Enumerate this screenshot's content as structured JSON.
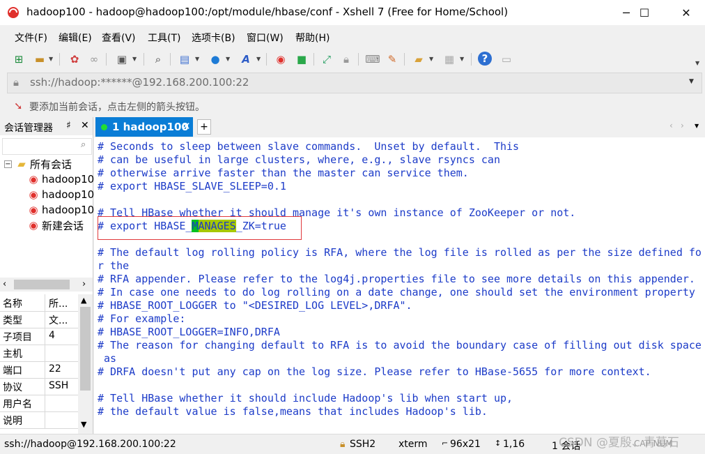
{
  "window": {
    "title": "hadoop100 - hadoop@hadoop100:/opt/module/hbase/conf - Xshell 7 (Free for Home/School)",
    "controls": [
      "─",
      "☐",
      "✕"
    ]
  },
  "menu": [
    "文件(F)",
    "编辑(E)",
    "查看(V)",
    "工具(T)",
    "选项卡(B)",
    "窗口(W)",
    "帮助(H)"
  ],
  "address": {
    "value": "ssh://hadoop:******@192.168.200.100:22"
  },
  "hint": {
    "text": "要添加当前会话，点击左侧的箭头按钮。"
  },
  "session_manager": {
    "title": "会话管理器",
    "pin": "♯",
    "close": "✕",
    "root": "所有会话",
    "items": [
      "hadoop10",
      "hadoop10",
      "hadoop10",
      "新建会话"
    ]
  },
  "properties": [
    {
      "k": "名称",
      "v": "所..."
    },
    {
      "k": "类型",
      "v": "文..."
    },
    {
      "k": "子项目",
      "v": "4"
    },
    {
      "k": "主机",
      "v": ""
    },
    {
      "k": "端口",
      "v": "22"
    },
    {
      "k": "协议",
      "v": "SSH"
    },
    {
      "k": "用户名",
      "v": ""
    },
    {
      "k": "说明",
      "v": ""
    }
  ],
  "tabs": [
    {
      "label": "1 hadoop100",
      "close": "✕"
    }
  ],
  "add_tab": "+",
  "terminal": {
    "lines": [
      "# Seconds to sleep between slave commands.  Unset by default.  This",
      "# can be useful in large clusters, where, e.g., slave rsyncs can",
      "# otherwise arrive faster than the master can service them.",
      "# export HBASE_SLAVE_SLEEP=0.1",
      "",
      "# Tell HBase whether it should manage it's own instance of ZooKeeper or not.",
      "",
      "",
      "# The default log rolling policy is RFA, where the log file is rolled as per the size defined fo",
      "r the",
      "# RFA appender. Please refer to the log4j.properties file to see more details on this appender.",
      "# In case one needs to do log rolling on a date change, one should set the environment property",
      "# HBASE_ROOT_LOGGER to \"<DESIRED_LOG LEVEL>,DRFA\".",
      "# For example:",
      "# HBASE_ROOT_LOGGER=INFO,DRFA",
      "# The reason for changing default to RFA is to avoid the boundary case of filling out disk space",
      " as",
      "# DRFA doesn't put any cap on the log size. Please refer to HBase-5655 for more context.",
      "",
      "# Tell HBase whether it should include Hadoop's lib when start up,",
      "# the default value is false,means that includes Hadoop's lib."
    ],
    "highlight_line": {
      "before": "# export HBASE_",
      "cursor": "M",
      "match": "ANAGES",
      "after": "_ZK=true"
    }
  },
  "status": {
    "connection": "ssh://hadoop@192.168.200.100:22",
    "protocol": "SSH2",
    "terminal_type": "xterm",
    "size": "96x21",
    "position": "1,16",
    "sessions": "1 会话",
    "caps": "CAP NUM"
  },
  "watermark": "CSDN @夏殷、青葛石",
  "colors": {
    "tab_active": "#0a7dd6",
    "terminal_text": "#1c3bc8",
    "search_highlight": "#a7c800",
    "cursor": "#00c020",
    "selection_box": "#e0393b"
  }
}
